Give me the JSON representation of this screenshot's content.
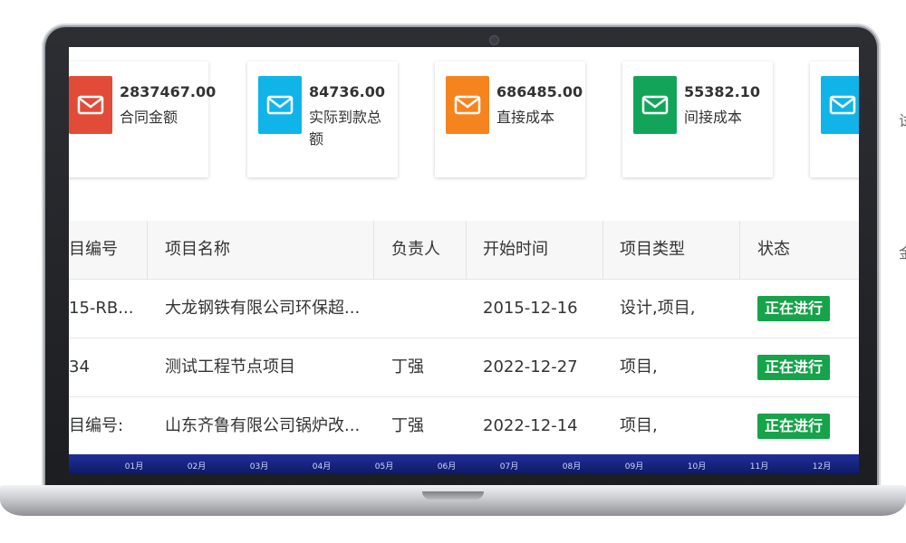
{
  "cards": [
    {
      "value": "2837467.00",
      "label": "合同金额",
      "color": "#e24b37",
      "icon": "mail-icon"
    },
    {
      "value": "84736.00",
      "label": "实际到款总额",
      "color": "#10b4e8",
      "icon": "mail-icon"
    },
    {
      "value": "686485.00",
      "label": "直接成本",
      "color": "#f5841f",
      "icon": "mail-icon"
    },
    {
      "value": "55382.10",
      "label": "间接成本",
      "color": "#12a55a",
      "icon": "mail-icon"
    },
    {
      "value": "",
      "label": "",
      "color": "#10b4e8",
      "icon": "mail-icon"
    }
  ],
  "table": {
    "headers": [
      "目编号",
      "项目名称",
      "负责人",
      "开始时间",
      "项目类型",
      "状态"
    ],
    "rows": [
      [
        "15-RB...",
        "大龙钢铁有限公司环保超...",
        "",
        "2015-12-16",
        "设计,项目,",
        "正在进行"
      ],
      [
        "34",
        "测试工程节点项目",
        "丁强",
        "2022-12-27",
        "项目,",
        "正在进行"
      ],
      [
        "目编号:",
        "山东齐鲁有限公司锅炉改...",
        "丁强",
        "2022-12-14",
        "项目,",
        "正在进行"
      ]
    ]
  },
  "months": [
    "01月",
    "02月",
    "03月",
    "04月",
    "05月",
    "06月",
    "07月",
    "08月",
    "09月",
    "10月",
    "11月",
    "12月"
  ],
  "bleed_text": [
    "试",
    "金"
  ]
}
